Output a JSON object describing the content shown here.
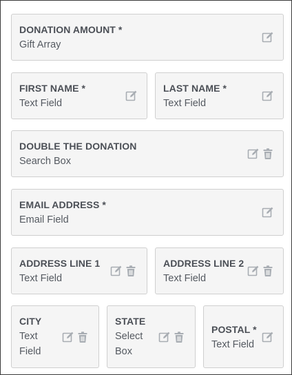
{
  "fields": {
    "donation_amount": {
      "label": "DONATION AMOUNT *",
      "type": "Gift Array"
    },
    "first_name": {
      "label": "FIRST NAME *",
      "type": "Text Field"
    },
    "last_name": {
      "label": "LAST NAME *",
      "type": "Text Field"
    },
    "double_the_donation": {
      "label": "DOUBLE THE DONATION",
      "type": "Search Box"
    },
    "email_address": {
      "label": "EMAIL ADDRESS *",
      "type": "Email Field"
    },
    "address_line_1": {
      "label": "ADDRESS LINE 1",
      "type": "Text Field"
    },
    "address_line_2": {
      "label": "ADDRESS LINE 2",
      "type": "Text Field"
    },
    "city": {
      "label": "CITY",
      "type": "Text Field"
    },
    "state": {
      "label": "STATE",
      "type": "Select Box"
    },
    "postal": {
      "label": "POSTAL *",
      "type": "Text Field"
    }
  },
  "icons": {
    "edit": "edit-icon",
    "delete": "trash-icon"
  },
  "colors": {
    "card_bg": "#f5f5f5",
    "card_border": "#cfcfcf",
    "label": "#4b4f56",
    "icon": "#a8adb3"
  }
}
